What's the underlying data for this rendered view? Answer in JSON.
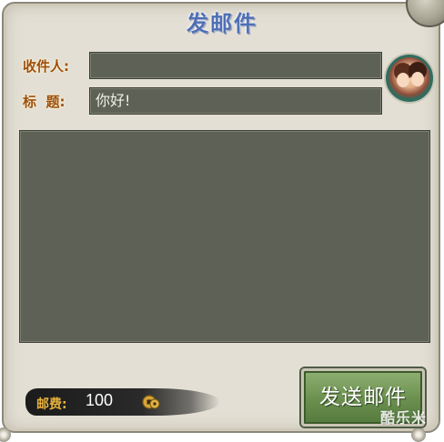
{
  "header": {
    "title": "发邮件"
  },
  "form": {
    "recipient_label": "收件人:",
    "recipient_value": "",
    "subject_label": "标  题:",
    "subject_value": "你好!",
    "body_value": ""
  },
  "footer": {
    "fee_label": "邮费:",
    "fee_value": "100",
    "currency_icon": "coin-icon",
    "send_label": "发送邮件"
  },
  "watermark": {
    "text": "酷乐米"
  },
  "colors": {
    "panel_bg": "#e3dfd4",
    "field_bg": "#5e6256",
    "label_color": "#9b4f0c",
    "title_color": "#4f6fb4",
    "button_green": "#6a8f4e",
    "fee_gold": "#e7b23c"
  }
}
